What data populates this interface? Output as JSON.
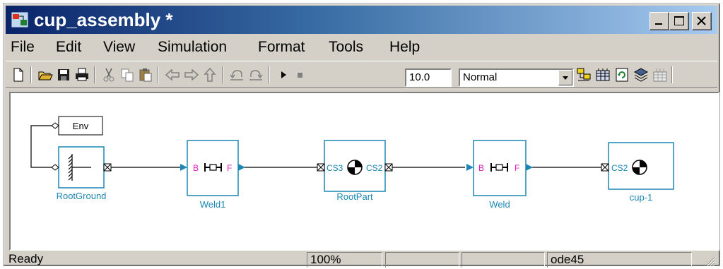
{
  "window": {
    "title": "cup_assembly *",
    "accent_color": "#0a246a",
    "controls": [
      "minimize-icon",
      "maximize-icon",
      "close-icon"
    ]
  },
  "menu": {
    "items": [
      "File",
      "Edit",
      "View",
      "Simulation",
      "Format",
      "Tools",
      "Help"
    ]
  },
  "toolbar": {
    "buttons": [
      "new-icon",
      "open-icon",
      "save-icon",
      "print-icon",
      "cut-icon",
      "copy-icon",
      "paste-icon",
      "back-icon",
      "forward-icon",
      "up-icon",
      "undo-icon",
      "redo-icon",
      "play-icon",
      "stop-icon",
      "build-icon",
      "library-icon",
      "refresh-icon",
      "model-explorer-icon",
      "debugger-icon"
    ],
    "stop_time": "10.0",
    "simulation_mode": "Normal"
  },
  "diagram": {
    "blocks": {
      "env": {
        "text": "Env"
      },
      "root_ground": {
        "label": "RootGround"
      },
      "weld1": {
        "label": "Weld1",
        "port_b": "B",
        "port_f": "F"
      },
      "root_part": {
        "label": "RootPart",
        "port_left": "CS3",
        "port_right": "CS2"
      },
      "weld": {
        "label": "Weld",
        "port_b": "B",
        "port_f": "F"
      },
      "cup": {
        "label": "cup-1",
        "port_left": "CS2"
      }
    },
    "colors": {
      "block_border": "#1c86b4",
      "port_magenta": "#e020c0"
    }
  },
  "status": {
    "text": "Ready",
    "zoom": "100%",
    "solver": "ode45"
  }
}
